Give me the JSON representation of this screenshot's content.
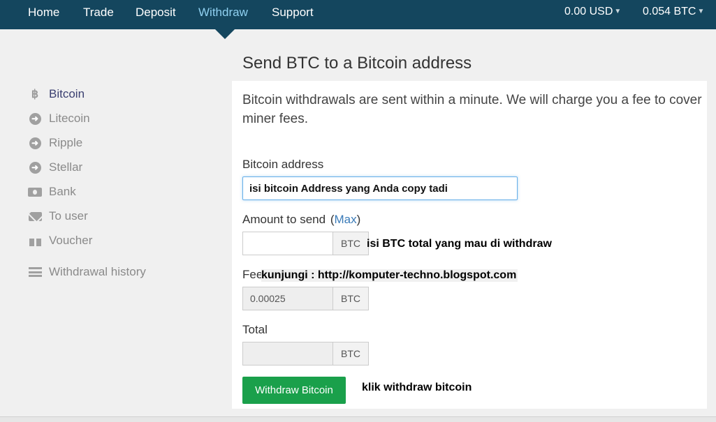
{
  "nav": {
    "items": [
      "Home",
      "Trade",
      "Deposit",
      "Withdraw",
      "Support"
    ],
    "active": "Withdraw",
    "balances": [
      "0.00 USD",
      "0.054 BTC"
    ]
  },
  "page": {
    "title": "Send BTC to a Bitcoin address"
  },
  "sidebar": {
    "items": [
      {
        "label": "Bitcoin",
        "icon": "bitcoin-icon",
        "active": true
      },
      {
        "label": "Litecoin",
        "icon": "arrow-circle-icon"
      },
      {
        "label": "Ripple",
        "icon": "arrow-circle-icon"
      },
      {
        "label": "Stellar",
        "icon": "arrow-circle-icon"
      },
      {
        "label": "Bank",
        "icon": "money-icon"
      },
      {
        "label": "To user",
        "icon": "envelope-icon"
      },
      {
        "label": "Voucher",
        "icon": "gift-icon"
      }
    ],
    "history": {
      "label": "Withdrawal history",
      "icon": "list-icon"
    }
  },
  "form": {
    "intro": "Bitcoin withdrawals are sent within a minute. We will charge you a fee to cover miner fees.",
    "address_label": "Bitcoin address",
    "address_value": "isi bitcoin Address yang Anda copy tadi",
    "amount_label": "Amount to send",
    "max_open": "(",
    "max_link": "Max",
    "max_close": ")",
    "amount_value": "",
    "amount_unit": "BTC",
    "fee_label": "Fee",
    "fee_value": "0.00025",
    "fee_unit": "BTC",
    "total_label": "Total",
    "total_value": "",
    "total_unit": "BTC",
    "submit_label": "Withdraw Bitcoin"
  },
  "annotations": {
    "amount_note": "isi BTC total yang mau di withdraw",
    "fee_note": "kunjungi : http://komputer-techno.blogspot.com",
    "submit_note": "klik withdraw bitcoin"
  },
  "colors": {
    "topbar": "#14465e",
    "active_nav": "#8fd0f0",
    "link": "#3a7bb8",
    "submit": "#1aa04b"
  }
}
